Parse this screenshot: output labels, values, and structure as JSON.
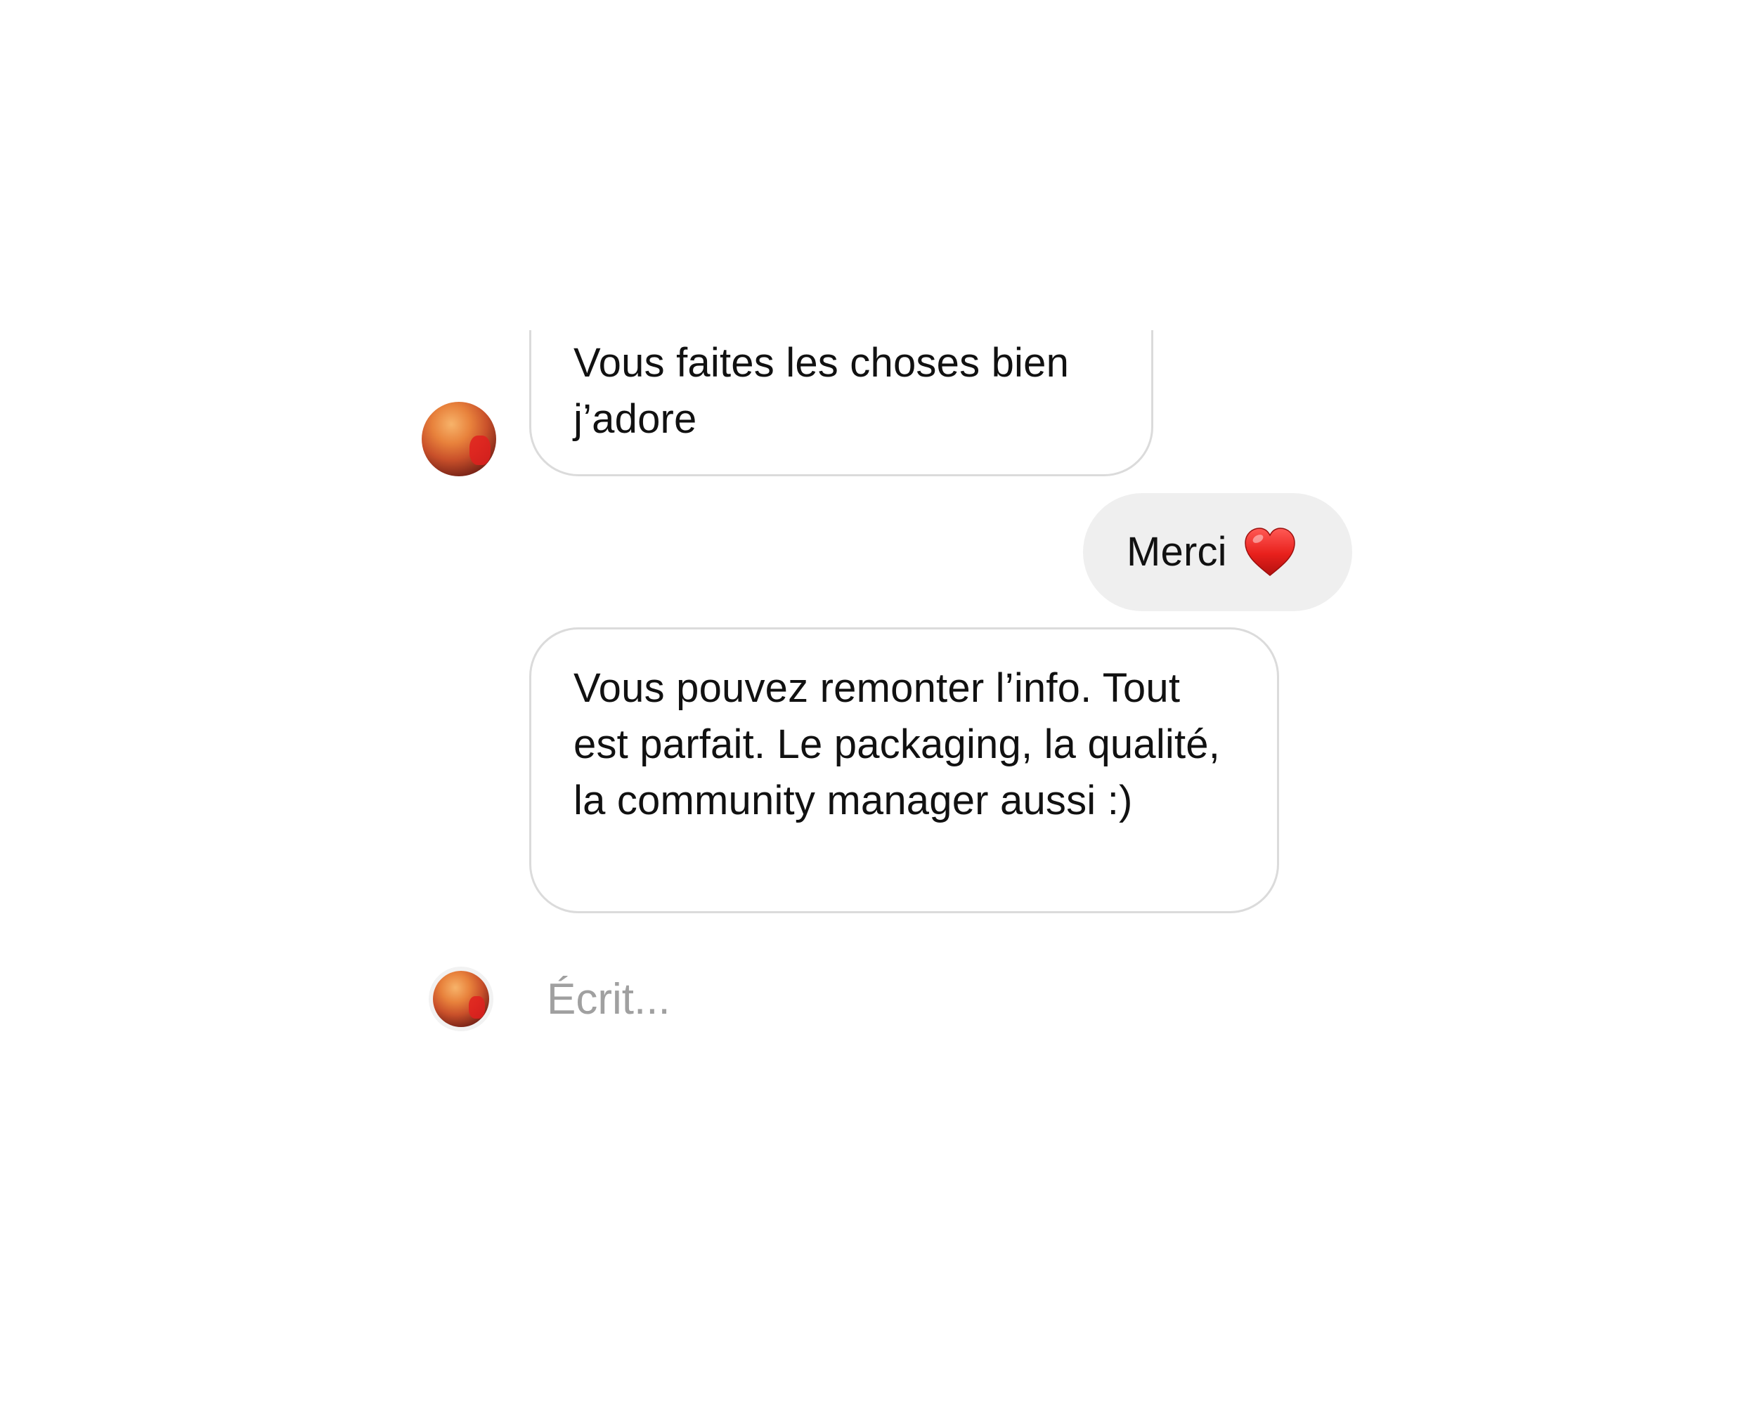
{
  "conversation": {
    "messages": [
      {
        "direction": "incoming",
        "text": "Vous faites les choses bien j’adore"
      },
      {
        "direction": "outgoing",
        "text": "Merci",
        "emoji": "heart-icon"
      },
      {
        "direction": "incoming",
        "text": "Vous pouvez remonter l’info. Tout est parfait. Le packaging, la qualité, la community manager aussi :)"
      }
    ],
    "composer": {
      "placeholder": "Écrit..."
    }
  },
  "colors": {
    "incoming_border": "#dbdbdb",
    "outgoing_background": "#efefef",
    "placeholder_text": "#a0a0a0",
    "heart": "#e0201e"
  }
}
